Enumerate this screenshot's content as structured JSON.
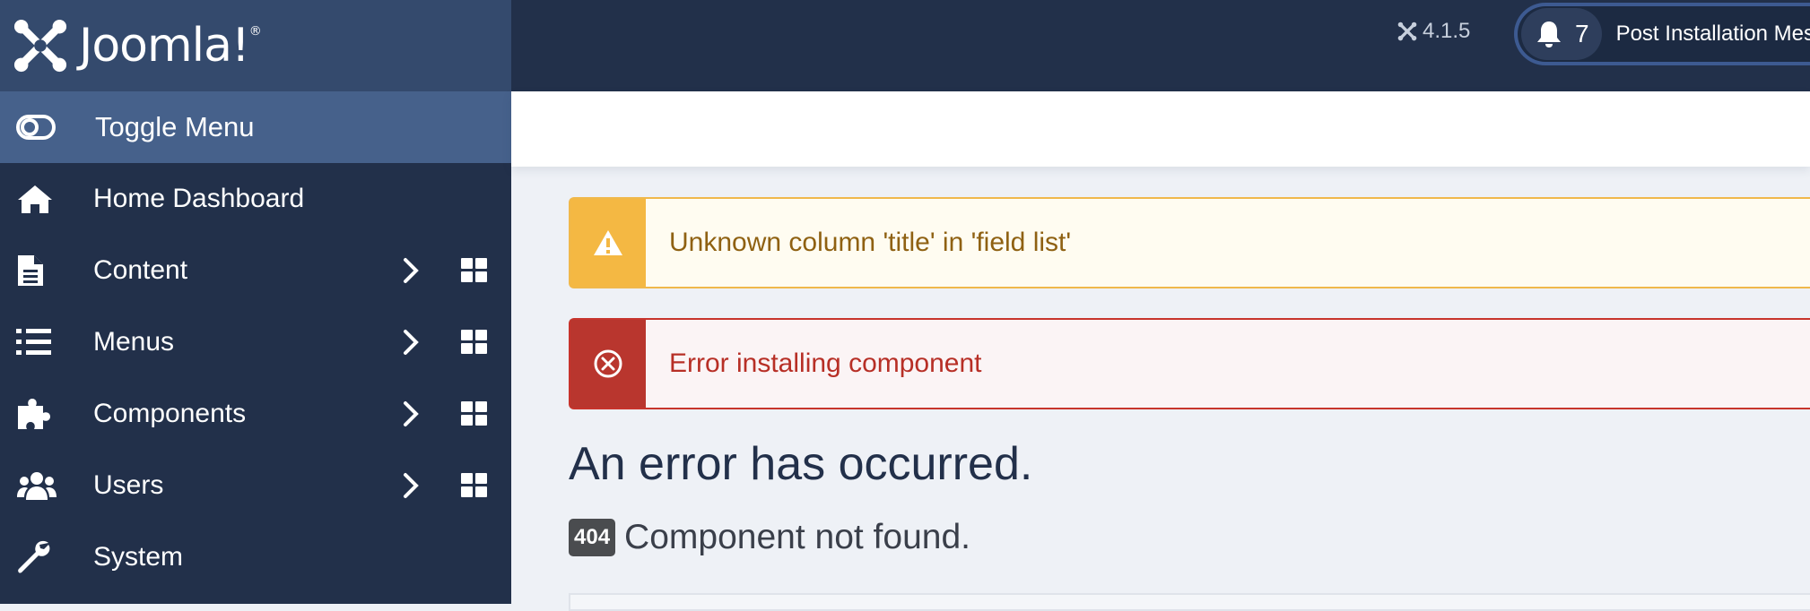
{
  "brand": {
    "name": "Joomla!",
    "logo_icon": "joomla-logo-icon"
  },
  "sidebar": {
    "toggle": {
      "label": "Toggle Menu",
      "icon": "toggle-switch-icon"
    },
    "items": [
      {
        "label": "Home Dashboard",
        "icon": "home-icon",
        "submenu": false
      },
      {
        "label": "Content",
        "icon": "document-icon",
        "submenu": true
      },
      {
        "label": "Menus",
        "icon": "list-icon",
        "submenu": true
      },
      {
        "label": "Components",
        "icon": "puzzle-icon",
        "submenu": true
      },
      {
        "label": "Users",
        "icon": "users-icon",
        "submenu": true
      },
      {
        "label": "System",
        "icon": "wrench-icon",
        "submenu": false
      }
    ]
  },
  "header": {
    "version": "4.1.5",
    "notification_count": "7",
    "post_install_label": "Post Installation Mes"
  },
  "alerts": {
    "warning": {
      "message": "Unknown column 'title' in 'field list'",
      "icon": "warning-triangle-icon"
    },
    "error": {
      "message": "Error installing component",
      "icon": "circle-x-icon"
    }
  },
  "error": {
    "heading": "An error has occurred.",
    "code": "404",
    "message": "Component not found."
  },
  "colors": {
    "sidebar_bg": "#22304a",
    "brand_bg": "#344a6d",
    "toggle_bg": "#46618b",
    "warning": "#f4b843",
    "danger": "#b9362e"
  }
}
